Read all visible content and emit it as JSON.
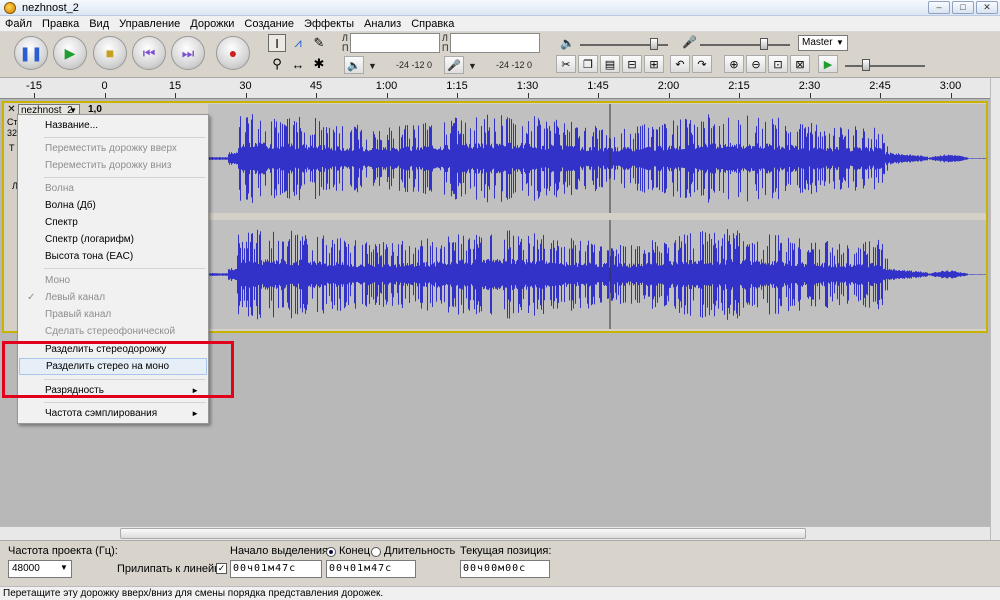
{
  "window": {
    "title": "nezhnost_2",
    "min": "–",
    "max": "□",
    "close": "✕"
  },
  "menu": [
    "Файл",
    "Правка",
    "Вид",
    "Управление",
    "Дорожки",
    "Создание",
    "Эффекты",
    "Анализ",
    "Справка"
  ],
  "toolbar": {
    "meter_letter_top": "Л",
    "meter_letter_bottom": "П",
    "meter_scale": "-24  -12  0",
    "device_select": "Master"
  },
  "ruler": {
    "labels": [
      "-15",
      "0",
      "15",
      "30",
      "45",
      "1:00",
      "1:15",
      "1:30",
      "1:45",
      "2:00",
      "2:15",
      "2:30",
      "2:45",
      "3:00"
    ]
  },
  "track": {
    "name": "nezhnost_2",
    "gain": "1,0",
    "close": "✕",
    "partial_labels": [
      "Ст",
      "32",
      "Т",
      "Л"
    ]
  },
  "context_menu": {
    "items": [
      {
        "label": "Название...",
        "state": "enabled"
      },
      {
        "label": "Переместить дорожку вверх",
        "state": "disabled"
      },
      {
        "label": "Переместить дорожку вниз",
        "state": "disabled"
      },
      {
        "label": "Волна",
        "state": "disabled"
      },
      {
        "label": "Волна (Дб)",
        "state": "enabled"
      },
      {
        "label": "Спектр",
        "state": "enabled"
      },
      {
        "label": "Спектр (логарифм)",
        "state": "enabled"
      },
      {
        "label": "Высота тона (EAC)",
        "state": "enabled"
      },
      {
        "label": "Моно",
        "state": "disabled"
      },
      {
        "label": "Левый канал",
        "state": "disabled",
        "checked": true
      },
      {
        "label": "Правый канал",
        "state": "disabled"
      },
      {
        "label": "Сделать стереофонической",
        "state": "disabled"
      },
      {
        "label": "Разделить стереодорожку",
        "state": "enabled"
      },
      {
        "label": "Разделить стерео на моно",
        "state": "hover"
      },
      {
        "label": "Разрядность",
        "state": "enabled",
        "submenu": true
      },
      {
        "label": "Частота сэмплирования",
        "state": "enabled",
        "submenu": true
      }
    ],
    "check_glyph": "✓",
    "submenu_glyph": "►"
  },
  "selection_bar": {
    "project_rate_label": "Частота проекта (Гц):",
    "project_rate_value": "48000",
    "snap_label": "Прилипать к линейке",
    "snap_checked": "✓",
    "selection_start_label": "Начало выделения:",
    "end_label": "Конец",
    "length_label": "Длительность",
    "current_position_label": "Текущая позиция:",
    "start_time": "00ч01м47с",
    "end_time": "00ч01м47с",
    "position_time": "00ч00м00с"
  },
  "status": "Перетащите эту дорожку вверх/вниз для смены порядка представления дорожек.",
  "colors": {
    "waveform": "#3232c8",
    "highlight": "#e2001a",
    "track_border": "#c8b400"
  }
}
